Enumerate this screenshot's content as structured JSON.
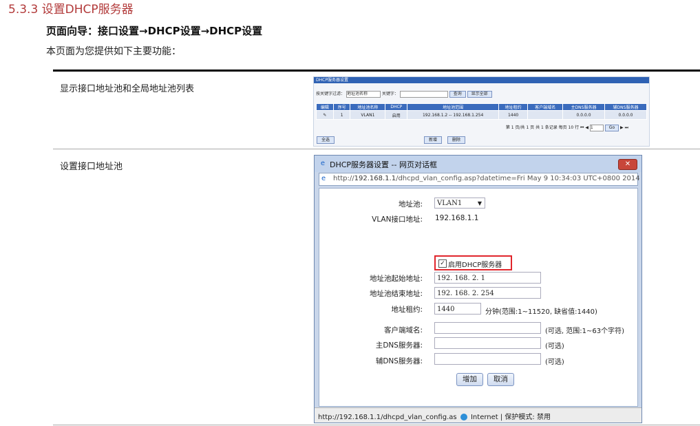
{
  "section": {
    "title": "5.3.3  设置DHCP服务器"
  },
  "nav_guide": "页面向导：接口设置→DHCP设置→DHCP设置",
  "intro": "本页面为您提供如下主要功能：",
  "rows": [
    {
      "label": "显示接口地址池和全局地址池列表"
    },
    {
      "label": "设置接口地址池"
    }
  ],
  "screenshot_list": {
    "bar_title": "DHCP服务器设置",
    "filter_label": "按关键字过滤：",
    "filter_select": "地址池名称",
    "keyword_label": "关键字：",
    "search_btn": "查询",
    "showall_btn": "显示全部",
    "columns": [
      "编辑",
      "序号",
      "地址池名称",
      "DHCP",
      "地址池范围",
      "地址租约",
      "客户端域名",
      "主DNS服务器",
      "辅DNS服务器"
    ],
    "row": [
      "",
      "1",
      "VLAN1",
      "启用",
      "192.168.1.2 -- 192.168.1.254",
      "1440",
      "",
      "0.0.0.0",
      "0.0.0.0"
    ],
    "pager": "第 1 页/共 1 页 共 1 条记录 每页 10 行",
    "page_input": "1",
    "go_btn": "Go",
    "left_btn": "全选",
    "add_btn": "新增",
    "del_btn": "删除"
  },
  "dialog": {
    "title": "DHCP服务器设置 -- 网页对话框",
    "url_prefix": "http://",
    "url_host": "192.168.1.1",
    "url_rest": "/dhcpd_vlan_config.asp?datetime=Fri May 9 10:34:03 UTC+0800 2014",
    "close": "✕",
    "fields": {
      "pool_label": "地址池:",
      "pool_value": "VLAN1",
      "vlan_ip_label": "VLAN接口地址:",
      "vlan_ip_value": "192.168.1.1",
      "enable_label": "启用DHCP服务器",
      "start_label": "地址池起始地址:",
      "start_value": "192. 168. 2. 1",
      "end_label": "地址池结束地址:",
      "end_value": "192. 168. 2. 254",
      "lease_label": "地址租约:",
      "lease_value": "1440",
      "lease_hint": "分钟(范围:1~11520, 缺省值:1440)",
      "domain_label": "客户端域名:",
      "domain_hint": "(可选, 范围:1~63个字符)",
      "dns1_label": "主DNS服务器:",
      "dns1_hint": "(可选)",
      "dns2_label": "辅DNS服务器:",
      "dns2_hint": "(可选)"
    },
    "add_button": "增加",
    "cancel_button": "取消",
    "status": {
      "url": "http://192.168.1.1/dhcpd_vlan_config.as",
      "zone": "Internet | 保护模式: 禁用"
    }
  }
}
